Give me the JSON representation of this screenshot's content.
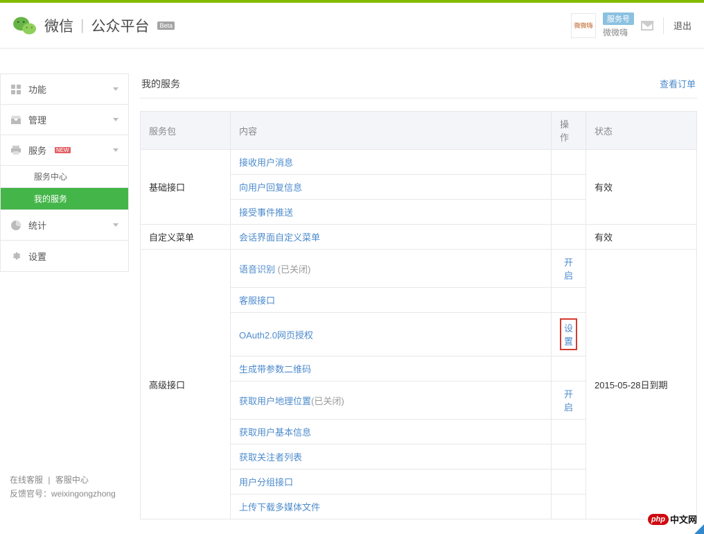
{
  "header": {
    "brand_left": "微信",
    "brand_right": "公众平台",
    "beta": "Beta",
    "thumb_text": "微微嗨",
    "service_type": "服务号",
    "username": "微微嗨",
    "logout": "退出"
  },
  "sidebar": {
    "groups": [
      {
        "icon": "grid-icon",
        "label": "功能",
        "expandable": true
      },
      {
        "icon": "inbox-icon",
        "label": "管理",
        "expandable": true
      },
      {
        "icon": "printer-icon",
        "label": "服务",
        "new_badge": "NEW",
        "expandable": true,
        "children": [
          {
            "label": "服务中心"
          },
          {
            "label": "我的服务",
            "active": true
          }
        ]
      },
      {
        "icon": "chart-icon",
        "label": "统计",
        "expandable": true
      },
      {
        "icon": "gear-icon",
        "label": "设置",
        "expandable": false
      }
    ],
    "footer": {
      "online_cs": "在线客服",
      "cs_center": "客服中心",
      "feedback_label": "反馈官号：",
      "feedback_account": "weixingongzhong"
    }
  },
  "panel": {
    "title": "我的服务",
    "orders_link": "查看订单"
  },
  "table": {
    "headers": {
      "package": "服务包",
      "content": "内容",
      "action": "操作",
      "status": "状态"
    },
    "rows": [
      {
        "package": "基础接口",
        "items": [
          {
            "content": "接收用户消息"
          },
          {
            "content": "向用户回复信息"
          },
          {
            "content": "接受事件推送"
          }
        ],
        "status": "有效"
      },
      {
        "package": "自定义菜单",
        "items": [
          {
            "content": "会话界面自定义菜单"
          }
        ],
        "status": "有效"
      },
      {
        "package": "高级接口",
        "items": [
          {
            "content": "语音识别",
            "suffix": " (已关闭)",
            "action": "开启"
          },
          {
            "content": "客服接口"
          },
          {
            "content": "OAuth2.0网页授权",
            "action": "设置",
            "highlight": true
          },
          {
            "content": "生成带参数二维码"
          },
          {
            "content": "获取用户地理位置",
            "suffix": "(已关闭)",
            "action": "开启"
          },
          {
            "content": "获取用户基本信息"
          },
          {
            "content": "获取关注者列表"
          },
          {
            "content": "用户分组接口"
          },
          {
            "content": "上传下载多媒体文件"
          }
        ],
        "status": "2015-05-28日到期"
      }
    ]
  },
  "watermark": {
    "badge": "php",
    "text": "中文网"
  }
}
